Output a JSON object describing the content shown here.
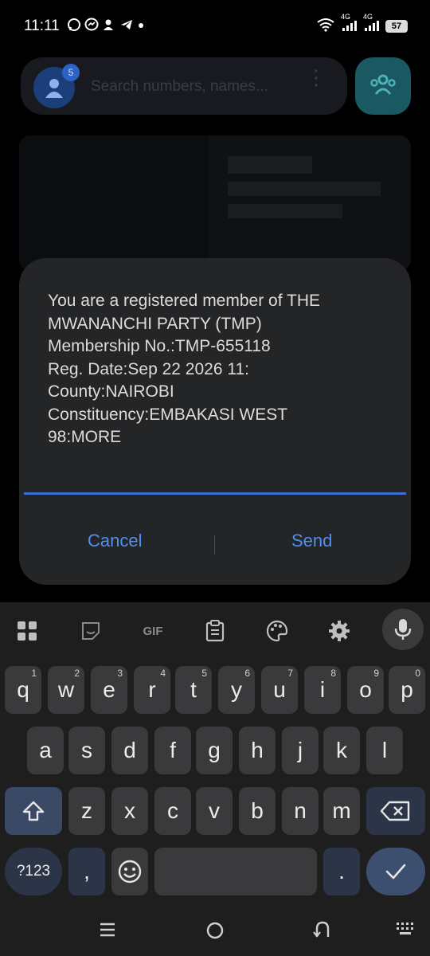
{
  "status_bar": {
    "time": "11:11",
    "left_icons": [
      "whatsapp-icon",
      "messenger-icon",
      "person-icon",
      "telegram-icon",
      "dot-icon"
    ],
    "network_1": "4G",
    "network_2": "4G",
    "battery": "57"
  },
  "background_app": {
    "search_placeholder": "Search numbers, names...",
    "avatar_badge": "5"
  },
  "dialog": {
    "message": "You are a registered member of THE MWANANCHI PARTY (TMP)\nMembership No.:TMP-655118\nReg. Date:Sep 22 2026 11:\nCounty:NAIROBI\nConstituency:EMBAKASI WEST\n98:MORE",
    "cancel_label": "Cancel",
    "send_label": "Send",
    "accent_color": "#4f8ff0"
  },
  "keyboard": {
    "toolbar": {
      "gif_label": "GIF"
    },
    "row1": [
      {
        "key": "q",
        "hint": "1"
      },
      {
        "key": "w",
        "hint": "2"
      },
      {
        "key": "e",
        "hint": "3"
      },
      {
        "key": "r",
        "hint": "4"
      },
      {
        "key": "t",
        "hint": "5"
      },
      {
        "key": "y",
        "hint": "6"
      },
      {
        "key": "u",
        "hint": "7"
      },
      {
        "key": "i",
        "hint": "8"
      },
      {
        "key": "o",
        "hint": "9"
      },
      {
        "key": "p",
        "hint": "0"
      }
    ],
    "row2": [
      "a",
      "s",
      "d",
      "f",
      "g",
      "h",
      "j",
      "k",
      "l"
    ],
    "row3": [
      "z",
      "x",
      "c",
      "v",
      "b",
      "n",
      "m"
    ],
    "symbols_label": "?123",
    "comma_label": ",",
    "period_label": "."
  }
}
